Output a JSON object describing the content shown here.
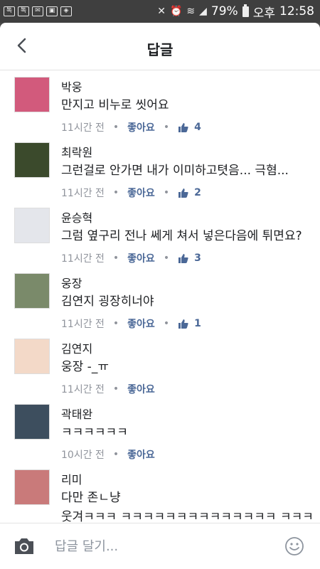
{
  "status_bar": {
    "battery": "79%",
    "ampm": "오후",
    "time": "12:58",
    "notif_icons": [
      "talk-icon",
      "talk-icon",
      "mail-icon",
      "image-icon",
      "app-icon"
    ]
  },
  "header": {
    "title": "답글",
    "back_icon": "chevron-left-icon"
  },
  "comments": [
    {
      "name": "박웅",
      "text": "만지고 비누로 씻어요",
      "time": "11시간 전",
      "like_label": "좋아요",
      "likes": "4",
      "avatar_color": "#d25a7c"
    },
    {
      "name": "최락원",
      "text": "그런걸로 안가면 내가 이미하고텻음... 극혐...",
      "time": "11시간 전",
      "like_label": "좋아요",
      "likes": "2",
      "avatar_color": "#3b4a2c"
    },
    {
      "name": "윤승혁",
      "text": "그럼 옆구리 전나 쎄게 쳐서 넣은다음에 튀면요?",
      "time": "11시간 전",
      "like_label": "좋아요",
      "likes": "3",
      "avatar_color": "#e4e6eb"
    },
    {
      "name": "웅장",
      "text": "김연지 굉장히너야",
      "time": "11시간 전",
      "like_label": "좋아요",
      "likes": "1",
      "avatar_color": "#7a8a6a"
    },
    {
      "name": "김연지",
      "text": "웅장 -_ㅠ",
      "time": "11시간 전",
      "like_label": "좋아요",
      "likes": "",
      "avatar_color": "#f3d9c8"
    },
    {
      "name": "곽태완",
      "text": "ㅋㅋㅋㅋㅋㅋ",
      "time": "10시간 전",
      "like_label": "좋아요",
      "likes": "",
      "avatar_color": "#3d4e5e"
    },
    {
      "name": "리미",
      "text": "다만 존ㄴ냥",
      "time": "",
      "like_label": "",
      "likes": "",
      "avatar_color": "#c97a7a"
    }
  ],
  "partial_text": "웃겨ㅋㅋㅋ ㅋㅋㅋㅋㅋㅋㅋㅋㅋㅋㅋㅋㅋㅋ ㅋㅋㅋ",
  "composer": {
    "placeholder": "답글 달기...",
    "camera_icon": "camera-icon",
    "sticker_icon": "smiley-icon"
  },
  "colors": {
    "like_blue": "#4b6897",
    "meta_gray": "#90949c"
  }
}
